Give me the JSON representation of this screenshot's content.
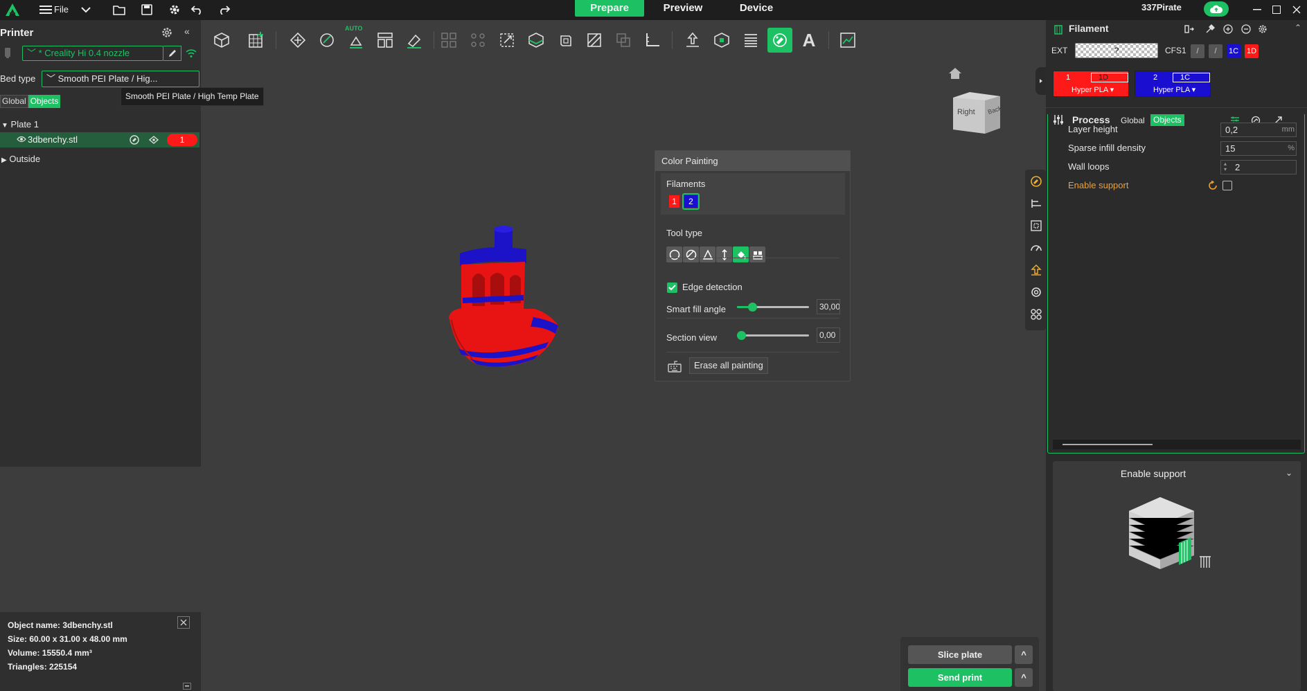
{
  "topbar": {
    "file_label": "File",
    "tabs": [
      {
        "label": "Prepare",
        "active": true
      },
      {
        "label": "Preview",
        "active": false
      },
      {
        "label": "Device",
        "active": false
      }
    ],
    "username": "337Pirate"
  },
  "left": {
    "printer_title": "Printer",
    "printer_value": "* Creality Hi 0.4 nozzle",
    "bed_type_label": "Bed type",
    "bed_type_value": "Smooth PEI Plate / Hig...",
    "bed_type_tooltip": "Smooth PEI Plate / High Temp Plate",
    "toggle_global": "Global",
    "toggle_objects": "Objects",
    "tree": {
      "plate": "Plate 1",
      "object": "3dbenchy.stl",
      "object_filament_badge": "1",
      "outside": "Outside"
    },
    "info": {
      "object_name": "Object name: 3dbenchy.stl",
      "size": "Size: 60.00 x 31.00 x 48.00 mm",
      "volume": "Volume: 15550.4 mm³",
      "triangles": "Triangles: 225154"
    }
  },
  "toolbar": {
    "auto_label": "AUTO",
    "active_tool": "color-painting",
    "text_tool_glyph": "A"
  },
  "viewcube": {
    "face_right": "Right",
    "face_back": "Back"
  },
  "paint_panel": {
    "title": "Color Painting",
    "filaments_label": "Filaments",
    "filament_1": "1",
    "filament_2": "2",
    "tool_type_label": "Tool type",
    "edge_detection_label": "Edge detection",
    "edge_detection_checked": true,
    "smart_fill_label": "Smart fill angle",
    "smart_fill_value": "30,00",
    "smart_fill_fraction": 0.18,
    "section_view_label": "Section view",
    "section_view_value": "0,00",
    "section_view_fraction": 0.0,
    "erase_label": "Erase all painting"
  },
  "right": {
    "filament_title": "Filament",
    "ext_label": "EXT",
    "ext_value": "?",
    "cfs_label": "CFS1",
    "cfs_slots": [
      "/",
      "/",
      "1C",
      "1D"
    ],
    "filaments": [
      {
        "index": "1",
        "code": "1D",
        "type": "Hyper PLA",
        "color": "#ff1a1a"
      },
      {
        "index": "2",
        "code": "1C",
        "type": "Hyper PLA",
        "color": "#1a0fd1"
      }
    ],
    "process_title": "Process",
    "process_global": "Global",
    "process_objects": "Objects",
    "settings": [
      {
        "label": "Layer height",
        "value": "0,2",
        "unit": "mm"
      },
      {
        "label": "Sparse infill density",
        "value": "15",
        "unit": "%"
      },
      {
        "label": "Wall loops",
        "value": "2",
        "unit": ""
      }
    ],
    "enable_support_label": "Enable support",
    "support_card_title": "Enable support"
  },
  "actions": {
    "slice": "Slice plate",
    "send": "Send print",
    "caret": "^"
  },
  "colors": {
    "accent": "#1ec064",
    "red": "#ff1a1a",
    "blue": "#1a0fd1",
    "support_orange": "#f0a030"
  }
}
